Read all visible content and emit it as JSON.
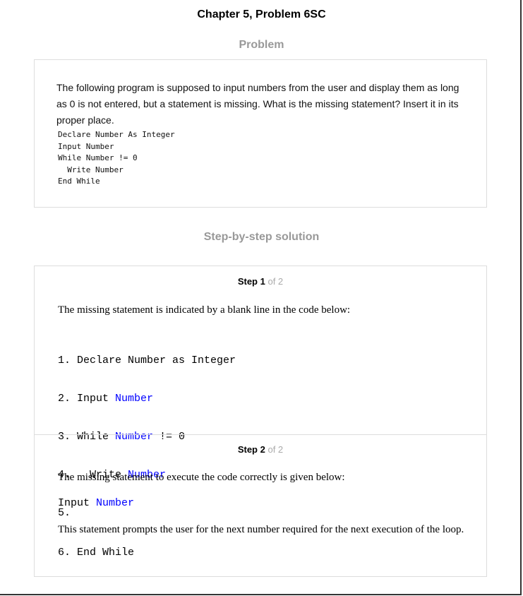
{
  "title": "Chapter 5, Problem 6SC",
  "problem_heading": "Problem",
  "problem_text": "The following program is supposed to input numbers from the user and display them as long as 0 is not entered, but a statement is missing. What is the missing statement? Insert it in its proper place.",
  "problem_code": [
    "Declare Number As Integer",
    "Input Number",
    "While Number != 0",
    "  Write Number",
    "End While"
  ],
  "solution_heading": "Step-by-step solution",
  "steps": [
    {
      "label": "Step 1",
      "of": "of 2",
      "text": "The missing statement is indicated by a blank line in the code below:",
      "code": [
        {
          "pre": "1. Declare Number as Integer",
          "kw": "",
          "post": ""
        },
        {
          "pre": "2. Input ",
          "kw": "Number",
          "post": ""
        },
        {
          "pre": "3. While ",
          "kw": "Number",
          "post": " != 0"
        },
        {
          "pre": "4.   Write ",
          "kw": "Number",
          "post": ""
        },
        {
          "pre": "5.",
          "kw": "",
          "post": ""
        },
        {
          "pre": "6. End While",
          "kw": "",
          "post": ""
        }
      ]
    },
    {
      "label": "Step 2",
      "of": "of 2",
      "text": "The missing statement to execute the code correctly is given below:",
      "code_pre": "Input ",
      "code_kw": "Number",
      "text2": "This statement prompts the user for the next number required for the next execution of the loop."
    }
  ]
}
